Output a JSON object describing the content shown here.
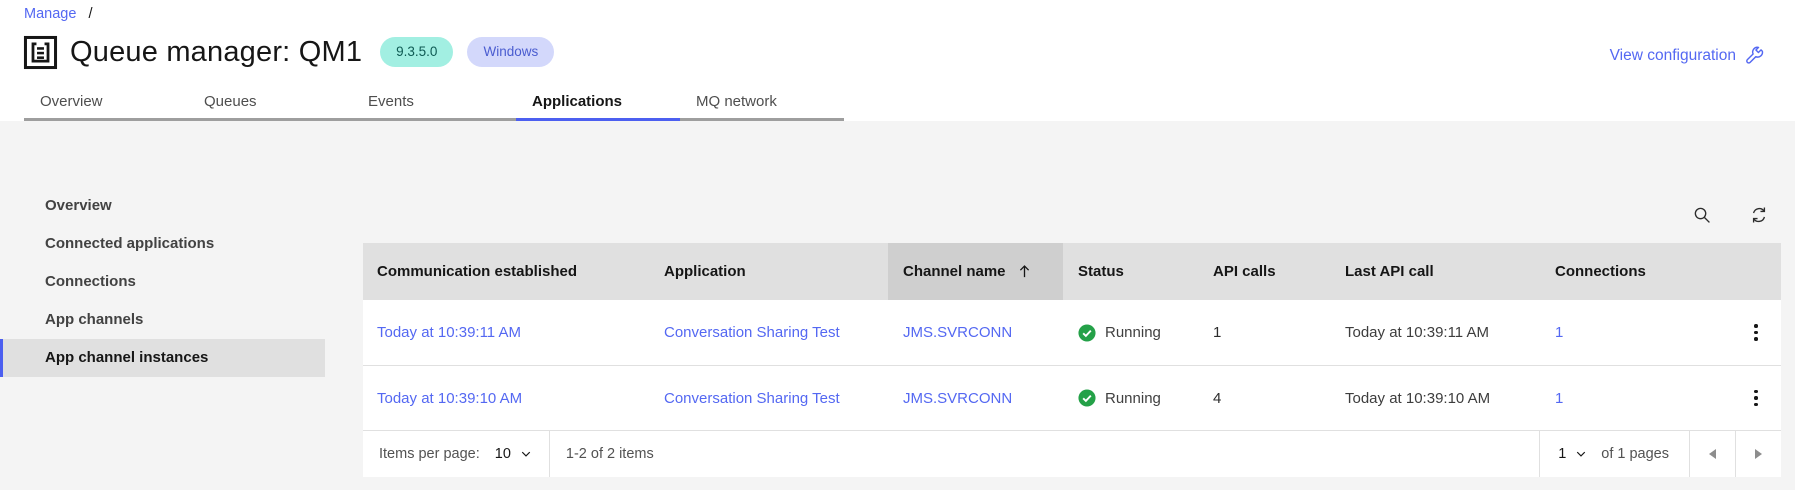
{
  "breadcrumb": {
    "items": [
      "Manage"
    ],
    "separator": "/"
  },
  "header": {
    "title": "Queue manager: QM1",
    "badges": [
      {
        "label": "9.3.5.0"
      },
      {
        "label": "Windows"
      }
    ],
    "action_label": "View configuration"
  },
  "tabs": {
    "items": [
      {
        "label": "Overview",
        "selected": false
      },
      {
        "label": "Queues",
        "selected": false
      },
      {
        "label": "Events",
        "selected": false
      },
      {
        "label": "Applications",
        "selected": true
      },
      {
        "label": "MQ network",
        "selected": false
      }
    ]
  },
  "sidebar": {
    "items": [
      {
        "label": "Overview",
        "selected": false
      },
      {
        "label": "Connected applications",
        "selected": false
      },
      {
        "label": "Connections",
        "selected": false
      },
      {
        "label": "App channels",
        "selected": false
      },
      {
        "label": "App channel instances",
        "selected": true
      }
    ]
  },
  "toolbar": {
    "icons": [
      "search-icon",
      "refresh-icon"
    ]
  },
  "table": {
    "columns": [
      {
        "label": "Communication established"
      },
      {
        "label": "Application"
      },
      {
        "label": "Channel name",
        "sorted": "ascending"
      },
      {
        "label": "Status"
      },
      {
        "label": "API calls"
      },
      {
        "label": "Last API call"
      },
      {
        "label": "Connections"
      }
    ],
    "rows": [
      {
        "communication_established": "Today at 10:39:11 AM",
        "application": "Conversation Sharing Test",
        "channel_name": "JMS.SVRCONN",
        "status": "Running",
        "api_calls": "1",
        "last_api_call": "Today at 10:39:11 AM",
        "connections": "1"
      },
      {
        "communication_established": "Today at 10:39:10 AM",
        "application": "Conversation Sharing Test",
        "channel_name": "JMS.SVRCONN",
        "status": "Running",
        "api_calls": "4",
        "last_api_call": "Today at 10:39:10 AM",
        "connections": "1"
      }
    ]
  },
  "pagination": {
    "items_per_page_label": "Items per page:",
    "items_per_page_value": "10",
    "range_text": "1-2 of 2 items",
    "page_value": "1",
    "pages_text": "of 1 pages"
  },
  "colors": {
    "accent": "#4c5ff0",
    "link": "#5468f2",
    "status-green": "#24a148",
    "badge1-bg": "#a2efe2",
    "badge1-fg": "#0e5a53",
    "badge2-bg": "#d3d8fb",
    "badge2-fg": "#4a5cd0"
  }
}
